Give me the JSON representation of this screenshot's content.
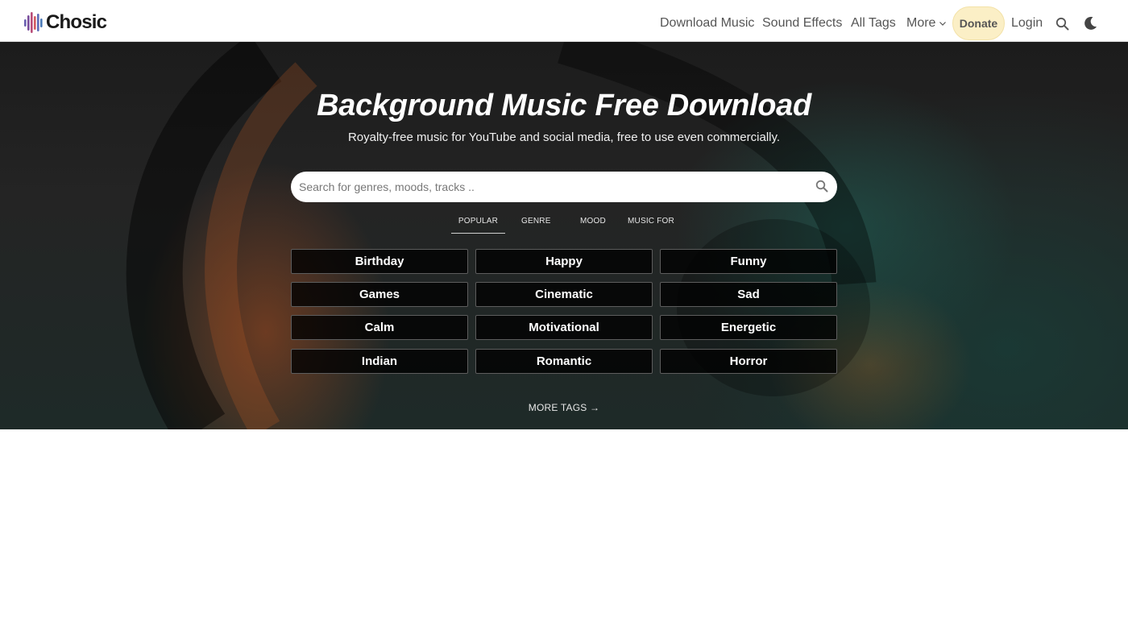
{
  "brand": {
    "name": "Chosic"
  },
  "nav": {
    "download_music": "Download Music",
    "sound_effects": "Sound Effects",
    "all_tags": "All Tags",
    "more": "More",
    "donate": "Donate",
    "login": "Login"
  },
  "hero": {
    "title": "Background Music Free Download",
    "subtitle": "Royalty-free music for YouTube and social media, free to use even commercially.",
    "search_placeholder": "Search for genres, moods, tracks ..",
    "search_value": "",
    "tabs": [
      "POPULAR",
      "GENRE",
      "MOOD",
      "MUSIC FOR"
    ],
    "active_tab": "POPULAR",
    "tags": [
      "Birthday",
      "Happy",
      "Funny",
      "Games",
      "Cinematic",
      "Sad",
      "Calm",
      "Motivational",
      "Energetic",
      "Indian",
      "Romantic",
      "Horror"
    ],
    "more_tags": "MORE TAGS →"
  },
  "colors": {
    "donate_bg": "#fbefc6",
    "header_bg": "#ffffff",
    "tag_bg": "#000000"
  },
  "icons": {
    "logo": "sound-bars-icon",
    "more": "chevron-down-icon",
    "search": "search-icon",
    "theme": "moon-icon"
  }
}
